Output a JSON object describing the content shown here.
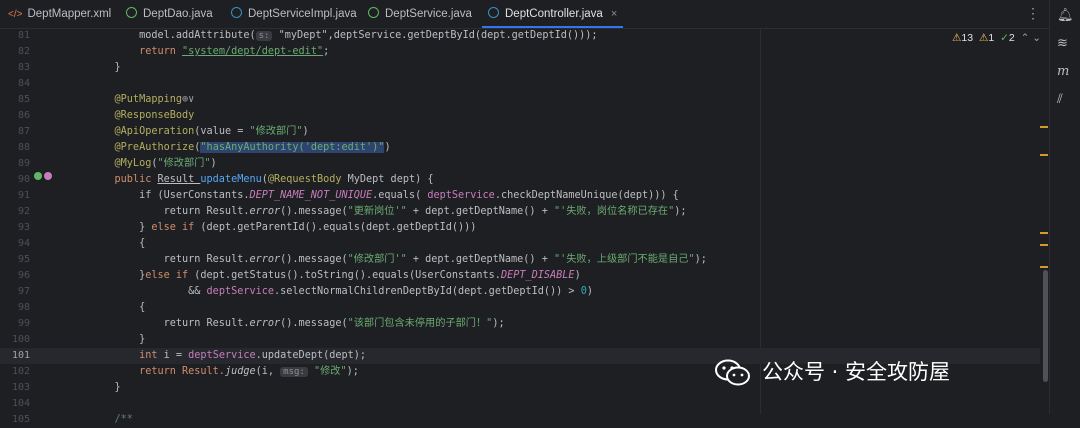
{
  "tabs": [
    {
      "label": "DeptMapper.xml",
      "icon": "xml-file-icon",
      "color": "#e07b53"
    },
    {
      "label": "DeptDao.java",
      "icon": "interface-icon",
      "color": "#5fb865"
    },
    {
      "label": "DeptServiceImpl.java",
      "icon": "class-icon",
      "color": "#3592c4"
    },
    {
      "label": "DeptService.java",
      "icon": "interface-icon",
      "color": "#5fb865"
    },
    {
      "label": "DeptController.java",
      "icon": "class-icon",
      "color": "#3592c4",
      "close": "×"
    }
  ],
  "kebab": "⋮",
  "inspections": {
    "warnings": "13",
    "weak": "1",
    "ok": "2"
  },
  "current_line": "101",
  "lines": [
    {
      "n": "81"
    },
    {
      "n": "82"
    },
    {
      "n": "83"
    },
    {
      "n": "84"
    },
    {
      "n": "85"
    },
    {
      "n": "86"
    },
    {
      "n": "87"
    },
    {
      "n": "88"
    },
    {
      "n": "89"
    },
    {
      "n": "90"
    },
    {
      "n": "91"
    },
    {
      "n": "92"
    },
    {
      "n": "93"
    },
    {
      "n": "94"
    },
    {
      "n": "95"
    },
    {
      "n": "96"
    },
    {
      "n": "97"
    },
    {
      "n": "98"
    },
    {
      "n": "99"
    },
    {
      "n": "100"
    },
    {
      "n": "101"
    },
    {
      "n": "102"
    },
    {
      "n": "103"
    },
    {
      "n": "104"
    },
    {
      "n": "105"
    }
  ],
  "code": {
    "l81a": "        model.addAttribute(",
    "l81h": "s:",
    "l81b": " \"myDept\",deptService.getDeptById(dept.getDeptId()));",
    "l82a": "        return ",
    "l82s": "\"system/dept/dept-edit\"",
    "l82b": ";",
    "l83": "    }",
    "l85": "    @PutMapping",
    "l86": "    @ResponseBody",
    "l87a": "    @ApiOperation",
    "l87b": "(value = ",
    "l87s": "\"修改部门\"",
    "l87c": ")",
    "l88a": "    @PreAuthorize",
    "l88b": "(",
    "l88s": "\"hasAnyAuthority('dept:edit')\"",
    "l88c": ")",
    "l89a": "    @MyLog",
    "l89b": "(",
    "l89s": "\"修改部门\"",
    "l89c": ")",
    "l90a": "    public ",
    "l90b": "Result ",
    "l90f": "updateMenu",
    "l90c": "(",
    "l90an": "@RequestBody ",
    "l90d": "MyDept dept) {",
    "l91a": "        if (UserConstants.",
    "l91cn": "DEPT_NAME_NOT_UNIQUE",
    "l91b": ".equals( ",
    "l91fd": "deptService",
    "l91c": ".checkDeptNameUnique(dept))) {",
    "l92a": "            return Result.",
    "l92i": "error",
    "l92b": "().message(",
    "l92s": "\"更新岗位'\"",
    "l92c": " + dept.getDeptName() + ",
    "l92s2": "\"'失败，岗位名称已存在\"",
    "l92d": ");",
    "l93a": "        } ",
    "l93k": "else if",
    "l93b": " (dept.getParentId().equals(dept.getDeptId()))",
    "l94": "        {",
    "l95a": "            return Result.",
    "l95i": "error",
    "l95b": "().message(",
    "l95s": "\"修改部门'\"",
    "l95c": " + dept.getDeptName() + ",
    "l95s2": "\"'失败，上级部门不能是自己\"",
    "l95d": ");",
    "l96a": "        }",
    "l96k": "else if",
    "l96b": " (dept.getStatus().toString().equals(UserConstants.",
    "l96cn": "DEPT_DISABLE",
    "l96c": ")",
    "l97a": "                && ",
    "l97fd": "deptService",
    "l97b": ".selectNormalChildrenDeptById(dept.getDeptId()) > ",
    "l97n": "0",
    "l97c": ")",
    "l98": "        {",
    "l99a": "            return Result.",
    "l99i": "error",
    "l99b": "().message(",
    "l99s": "\"该部门包含未停用的子部门！\"",
    "l99c": ");",
    "l100": "        }",
    "l101a": "        int ",
    "l101b": "i = ",
    "l101fd": "deptService",
    "l101c": ".updateDept(dept);",
    "l102a": "        return Result.",
    "l102i": "judge",
    "l102b": "(i, ",
    "l102h": "msg:",
    "l102s": " \"修改\"",
    "l102c": ");",
    "l103": "    }",
    "l105": "    /**"
  },
  "toolstrip": [
    "bell-icon",
    "database-icon",
    "maven-icon",
    "analyzer-icon"
  ],
  "watermark": "公众号 · 安全攻防屋"
}
